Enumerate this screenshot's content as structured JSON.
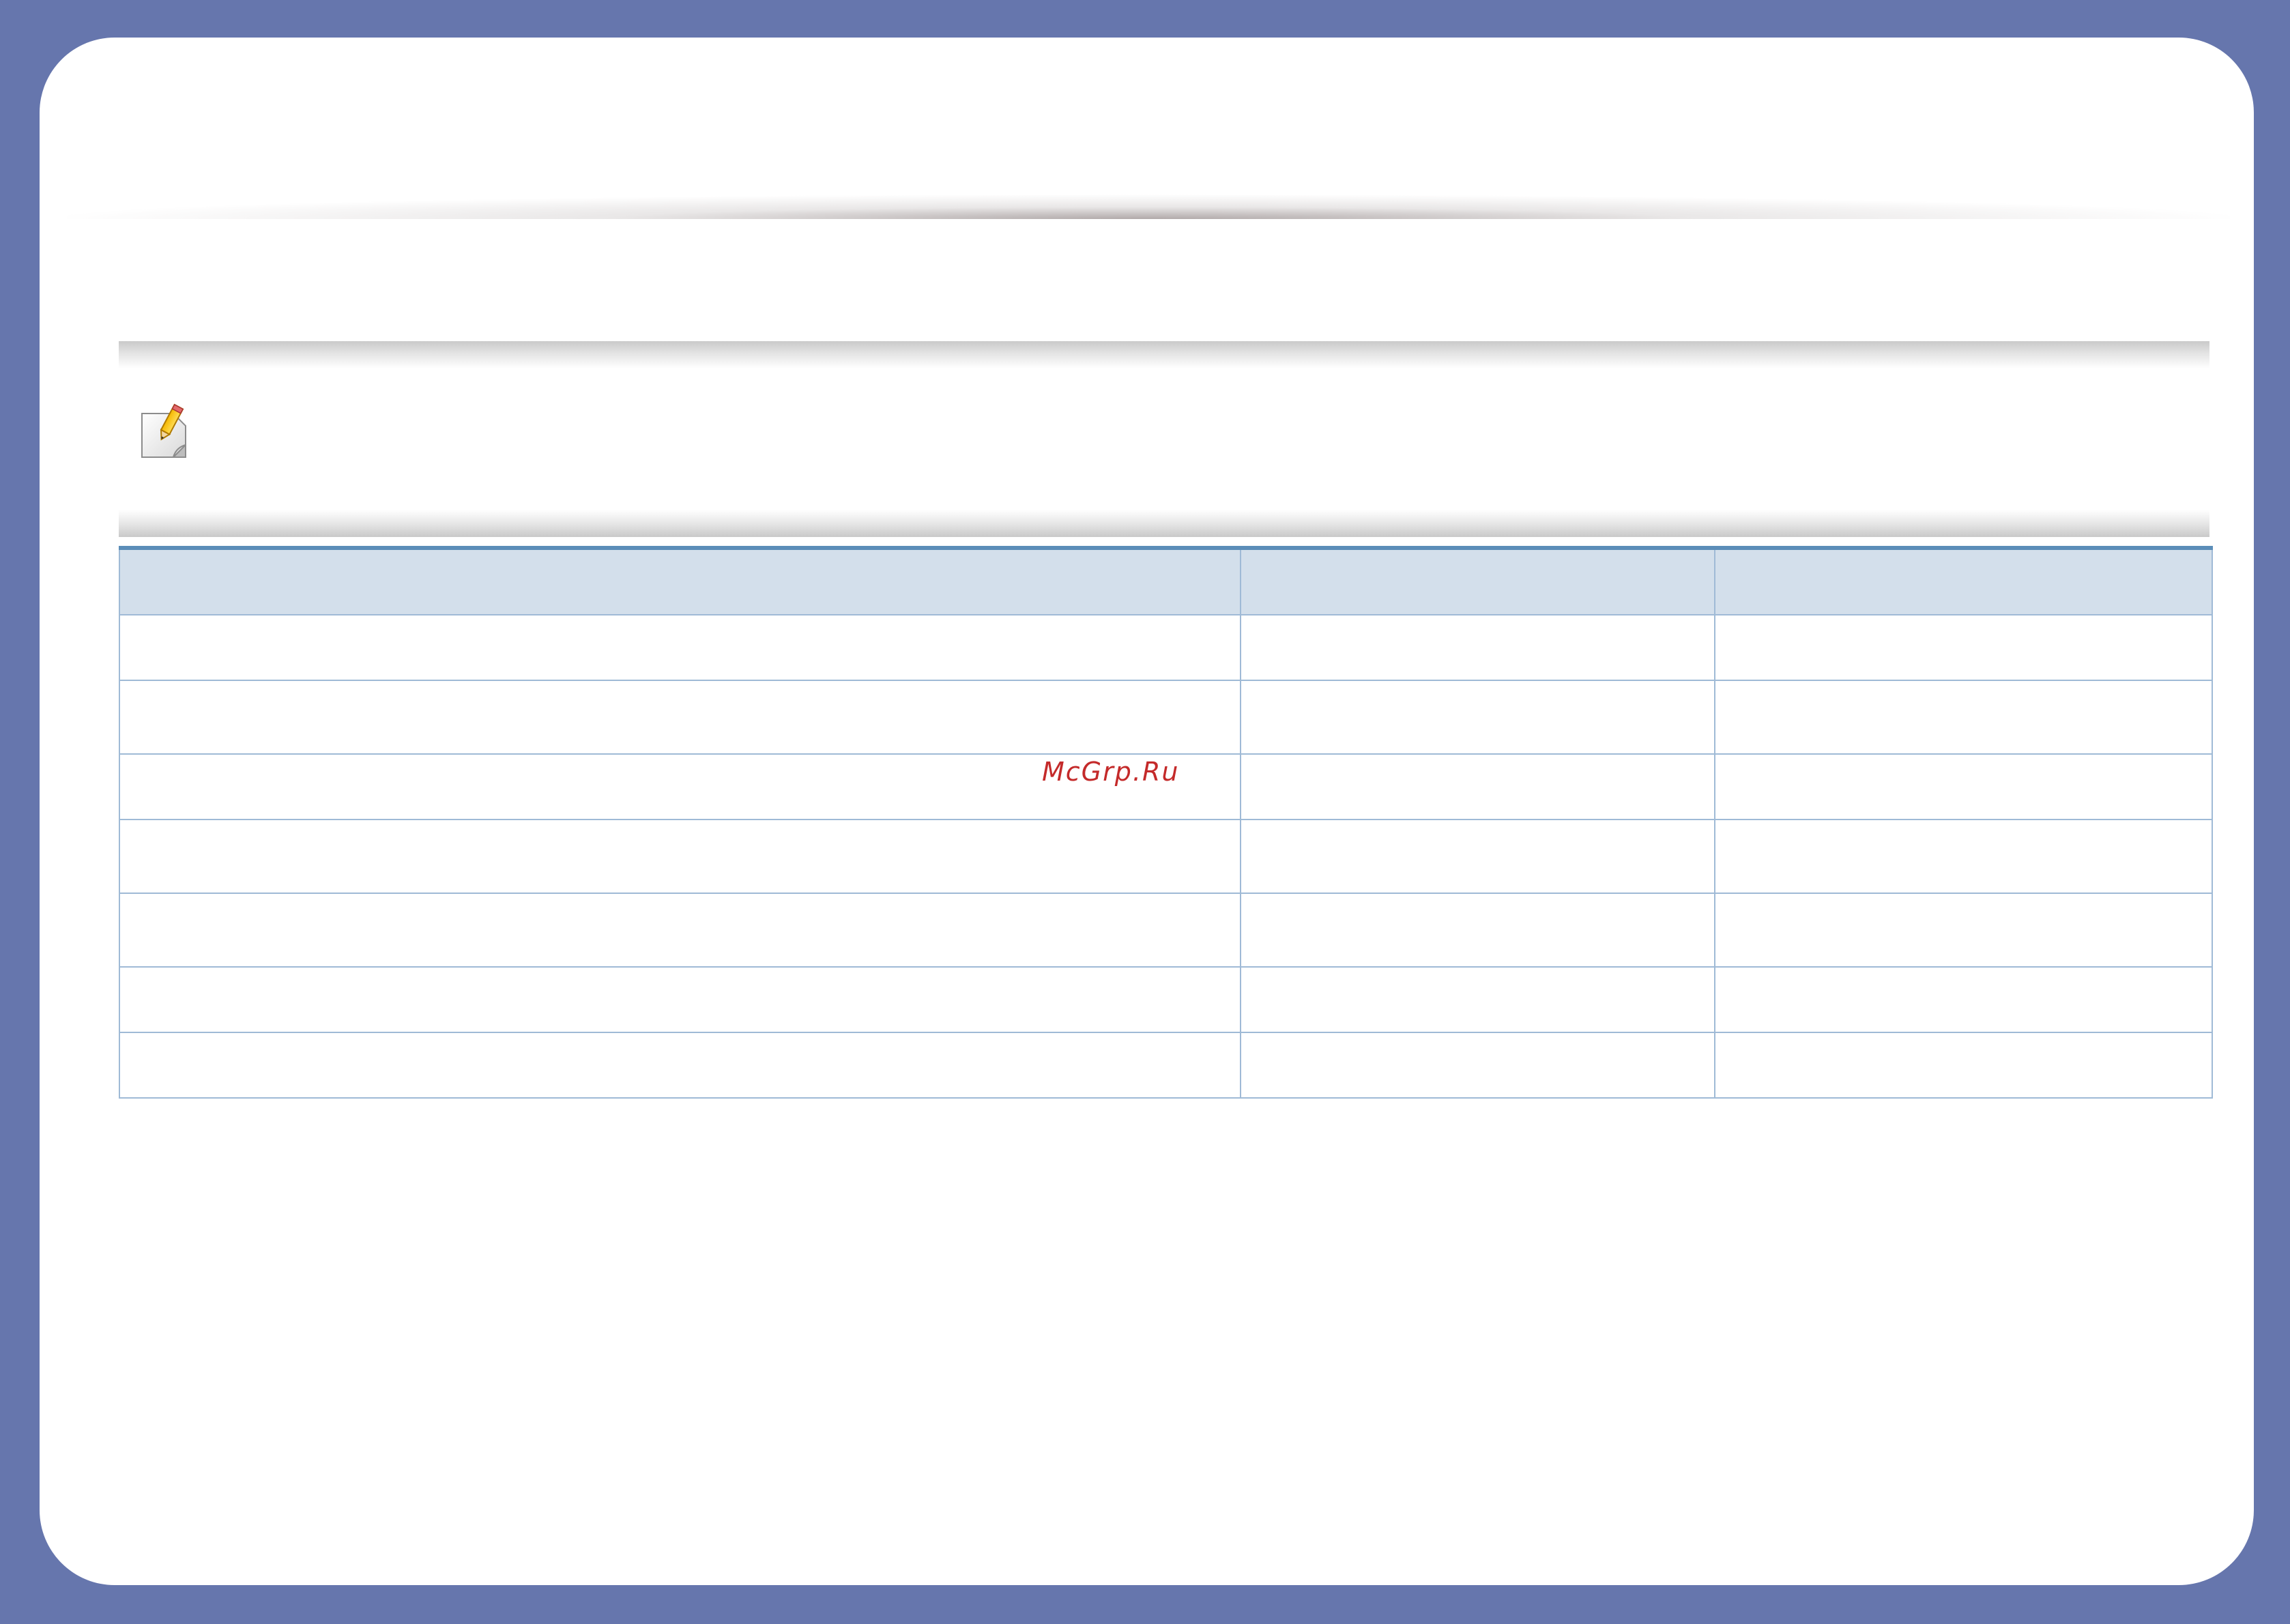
{
  "note": {
    "icon": "note-pencil-icon",
    "text": ""
  },
  "table": {
    "header": [
      "",
      "",
      ""
    ],
    "rows": [
      [
        "",
        "",
        ""
      ],
      [
        "",
        "",
        ""
      ],
      [
        "",
        "",
        ""
      ],
      [
        "",
        "",
        ""
      ],
      [
        "",
        "",
        ""
      ],
      [
        "",
        "",
        ""
      ],
      [
        "",
        "",
        ""
      ]
    ]
  },
  "watermark": "McGrp.Ru",
  "colors": {
    "frame": "#6676ad",
    "table_header_bg": "#d3dfeb",
    "table_border": "#9fbad6",
    "table_top_rule": "#5b8db8",
    "watermark": "#c42a2a"
  }
}
